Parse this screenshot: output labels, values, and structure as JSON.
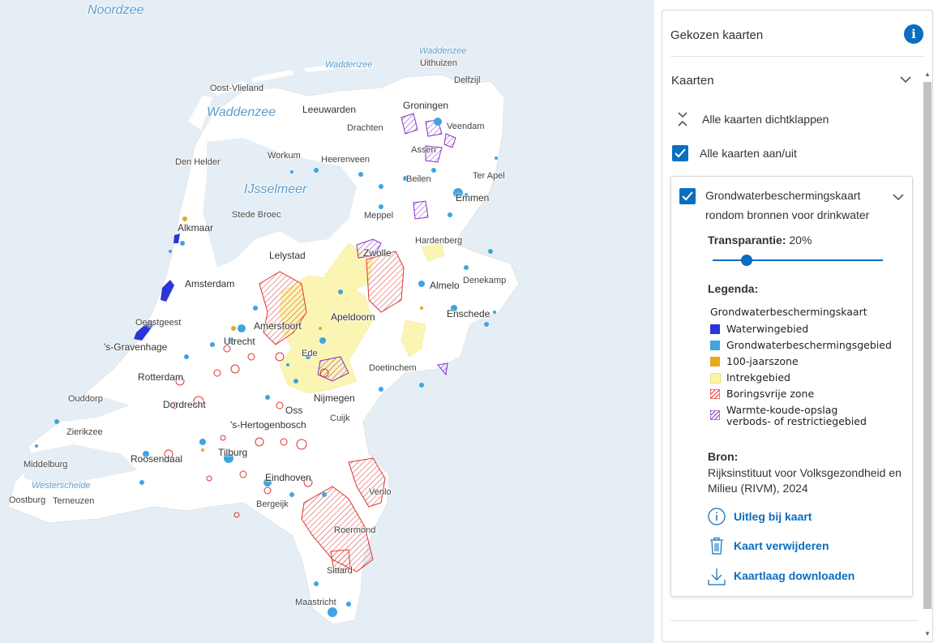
{
  "map": {
    "water_labels": [
      {
        "id": "noordzee",
        "text": "Noordzee"
      },
      {
        "id": "waddenzee-north",
        "text": "Waddenzee"
      },
      {
        "id": "waddenzee-ne",
        "text": "Waddenzee"
      },
      {
        "id": "waddenzee",
        "text": "Waddenzee"
      },
      {
        "id": "ijsselmeer",
        "text": "IJsselmeer"
      },
      {
        "id": "westerschelde",
        "text": "Westerschelde"
      }
    ],
    "places": [
      "Uithuizen",
      "Delfzijl",
      "Oost-Vlieland",
      "Leeuwarden",
      "Groningen",
      "Drachten",
      "Veendam",
      "Assen",
      "Workum",
      "Den Helder",
      "Heerenveen",
      "Beilen",
      "Ter Apel",
      "Emmen",
      "Stede Broec",
      "Meppel",
      "Alkmaar",
      "Hardenberg",
      "Lelystad",
      "Zwolle",
      "Amsterdam",
      "Almelo",
      "Denekamp",
      "Oegstgeest",
      "Apeldoorn",
      "Enschede",
      "Amersfoort",
      "'s-Gravenhage",
      "Utrecht",
      "Ede",
      "Rotterdam",
      "Doetinchem",
      "Ouddorp",
      "Dordrecht",
      "Nijmegen",
      "Oss",
      "Zierikzee",
      "Cuijk",
      "'s-Hertogenbosch",
      "Roosendaal",
      "Tilburg",
      "Middelburg",
      "Eindhoven",
      "Venlo",
      "Oostburg",
      "Terneuzen",
      "Bergeijk",
      "Roermond",
      "Sittard",
      "Maastricht"
    ]
  },
  "panel": {
    "title": "Gekozen kaarten",
    "section": "Kaarten",
    "collapse_all": "Alle kaarten dichtklappen",
    "toggle_all": "Alle kaarten aan/uit",
    "layer": {
      "title": "Grondwaterbeschermingskaart rondom bronnen voor drinkwater",
      "transparency_label": "Transparantie:",
      "transparency_value": "20%",
      "transparency_fraction": 0.2,
      "legend_title": "Legenda:",
      "legend_header": "Grondwaterbeschermingskaart",
      "legend": [
        {
          "label": "Waterwingebied",
          "color": "#2b35d8",
          "style": "fill"
        },
        {
          "label": "Grondwaterbeschermingsgebied",
          "color": "#41a3e0",
          "style": "fill"
        },
        {
          "label": "100-jaarszone",
          "color": "#e8a81c",
          "style": "fill"
        },
        {
          "label": "Intrekgebied",
          "color": "#fbf5a8",
          "style": "fill"
        },
        {
          "label": "Boringsvrije zone",
          "color": "#e0332f",
          "style": "hatch"
        },
        {
          "label": "Warmte-koude-opslag verbods- of restrictiegebied",
          "color": "#8a2bc7",
          "style": "hatch"
        }
      ],
      "source_title": "Bron:",
      "source_text": "Rijksinstituut voor Volksgezondheid en Milieu (RIVM), 2024",
      "actions": {
        "info": "Uitleg bij kaart",
        "delete": "Kaart verwijderen",
        "download": "Kaartlaag downloaden"
      }
    }
  }
}
